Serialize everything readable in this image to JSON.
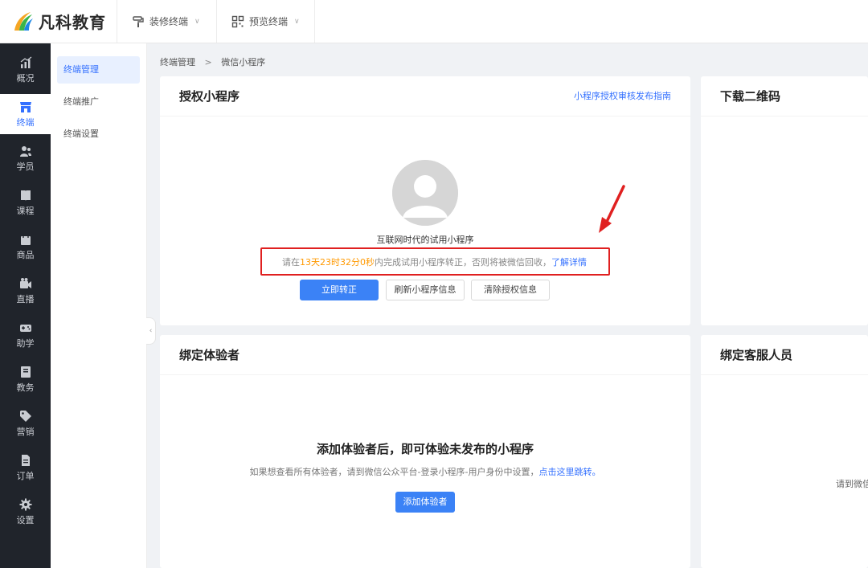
{
  "brand": {
    "name": "凡科教育"
  },
  "topnav": [
    {
      "label": "装修终端",
      "icon": "paint-roller-icon"
    },
    {
      "label": "预览终端",
      "icon": "qr-code-icon"
    }
  ],
  "sidebar": {
    "items": [
      {
        "label": "概况",
        "icon": "chart-icon"
      },
      {
        "label": "终端",
        "icon": "store-icon"
      },
      {
        "label": "学员",
        "icon": "users-icon"
      },
      {
        "label": "课程",
        "icon": "book-icon"
      },
      {
        "label": "商品",
        "icon": "bag-icon"
      },
      {
        "label": "直播",
        "icon": "video-camera-icon"
      },
      {
        "label": "助学",
        "icon": "gamepad-icon"
      },
      {
        "label": "教务",
        "icon": "notebook-icon"
      },
      {
        "label": "营销",
        "icon": "tag-icon"
      },
      {
        "label": "订单",
        "icon": "document-icon"
      },
      {
        "label": "设置",
        "icon": "gear-icon"
      }
    ],
    "active": "终端"
  },
  "submenu": {
    "items": [
      "终端管理",
      "终端推广",
      "终端设置"
    ],
    "active": "终端管理"
  },
  "breadcrumb": {
    "parent": "终端管理",
    "separator": ">",
    "current": "微信小程序"
  },
  "auth_card": {
    "title": "授权小程序",
    "guide_link": "小程序授权审核发布指南",
    "mini_name": "互联网时代的试用小程序",
    "notice_prefix": "请在",
    "notice_time": "13天23时32分0秒",
    "notice_middle": "内完成试用小程序转正，否则将被微信回收，",
    "notice_link": "了解详情",
    "btn_convert": "立即转正",
    "btn_refresh": "刷新小程序信息",
    "btn_clear": "清除授权信息"
  },
  "qr_card": {
    "title": "下载二维码"
  },
  "tester_card": {
    "title": "绑定体验者",
    "empty_title": "添加体验者后，即可体验未发布的小程序",
    "desc_prefix": "如果想查看所有体验者，请到微信公众平台-登录小程序-用户身份中设置，",
    "desc_link": "点击这里跳转。",
    "btn_add": "添加体验者"
  },
  "service_card": {
    "title": "绑定客服人员",
    "hint": "请到微信"
  },
  "colors": {
    "primary": "#3370ff",
    "warning": "#ff9900",
    "highlight_border": "#e02020",
    "sidebar_bg": "#20242b"
  }
}
